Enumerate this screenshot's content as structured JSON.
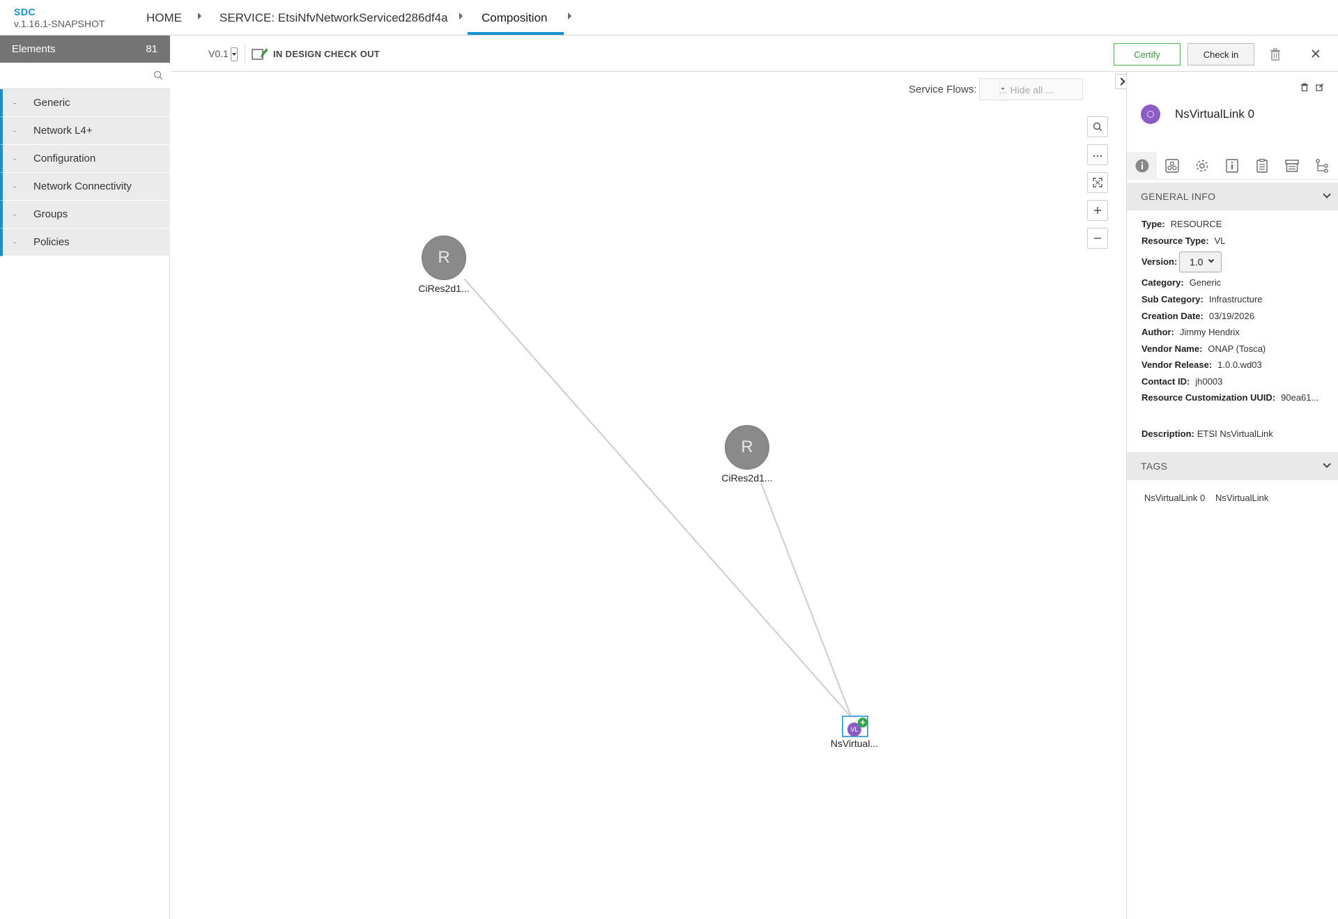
{
  "app": {
    "name": "SDC",
    "version": "v.1.16.1-SNAPSHOT"
  },
  "breadcrumb": {
    "home": "HOME",
    "service": "SERVICE: EtsiNfvNetworkServiced286df4a",
    "current": "Composition"
  },
  "left": {
    "title": "Elements",
    "count": "81",
    "search_placeholder": "",
    "categories": [
      {
        "dash": "-",
        "label": "Generic"
      },
      {
        "dash": "-",
        "label": "Network L4+"
      },
      {
        "dash": "-",
        "label": "Configuration"
      },
      {
        "dash": "-",
        "label": "Network Connectivity"
      },
      {
        "dash": "-",
        "label": "Groups"
      },
      {
        "dash": "-",
        "label": "Policies"
      }
    ]
  },
  "toolbar": {
    "version": "V0.1",
    "status": "IN DESIGN CHECK OUT",
    "certify": "Certify",
    "checkin": "Check in"
  },
  "canvas": {
    "service_flows_label": "Service Flows:",
    "service_flows_value": "... Hide all ...",
    "zoom_buttons": [
      "search",
      "more",
      "fit",
      "zoom-in",
      "zoom-out"
    ],
    "nodes": [
      {
        "letter": "R",
        "label": "CiRes2d1..."
      },
      {
        "letter": "R",
        "label": "CiRes2d1..."
      },
      {
        "letter": "VL",
        "label": "NsVirtual..."
      }
    ]
  },
  "panel": {
    "component_name": "NsVirtualLink 0",
    "avatar_color": "#8b5cc5",
    "general_info_title": "GENERAL INFO",
    "type_label": "Type:",
    "type_value": "RESOURCE",
    "resource_type_label": "Resource Type:",
    "resource_type_value": "VL",
    "version_label": "Version:",
    "version_value": "1.0",
    "category_label": "Category:",
    "category_value": "Generic",
    "subcategory_label": "Sub Category:",
    "subcategory_value": "Infrastructure",
    "creation_label": "Creation Date:",
    "creation_value": "03/19/2026",
    "author_label": "Author:",
    "author_value": "Jimmy Hendrix",
    "vendor_label": "Vendor Name:",
    "vendor_value": "ONAP (Tosca)",
    "release_label": "Vendor Release:",
    "release_value": "1.0.0.wd03",
    "contact_label": "Contact ID:",
    "contact_value": "jh0003",
    "uuid_label": "Resource Customization UUID:",
    "uuid_value": "90ea61...",
    "description_label": "Description:",
    "description_value": "ETSI NsVirtualLink",
    "tags_title": "TAGS",
    "tags": [
      "NsVirtualLink 0",
      "NsVirtualLink"
    ]
  },
  "colors": {
    "accent": "#1a8fcf",
    "certify": "#4caf50",
    "node_gray": "#8a8a8a",
    "vl_purple": "#8b5cc5"
  }
}
